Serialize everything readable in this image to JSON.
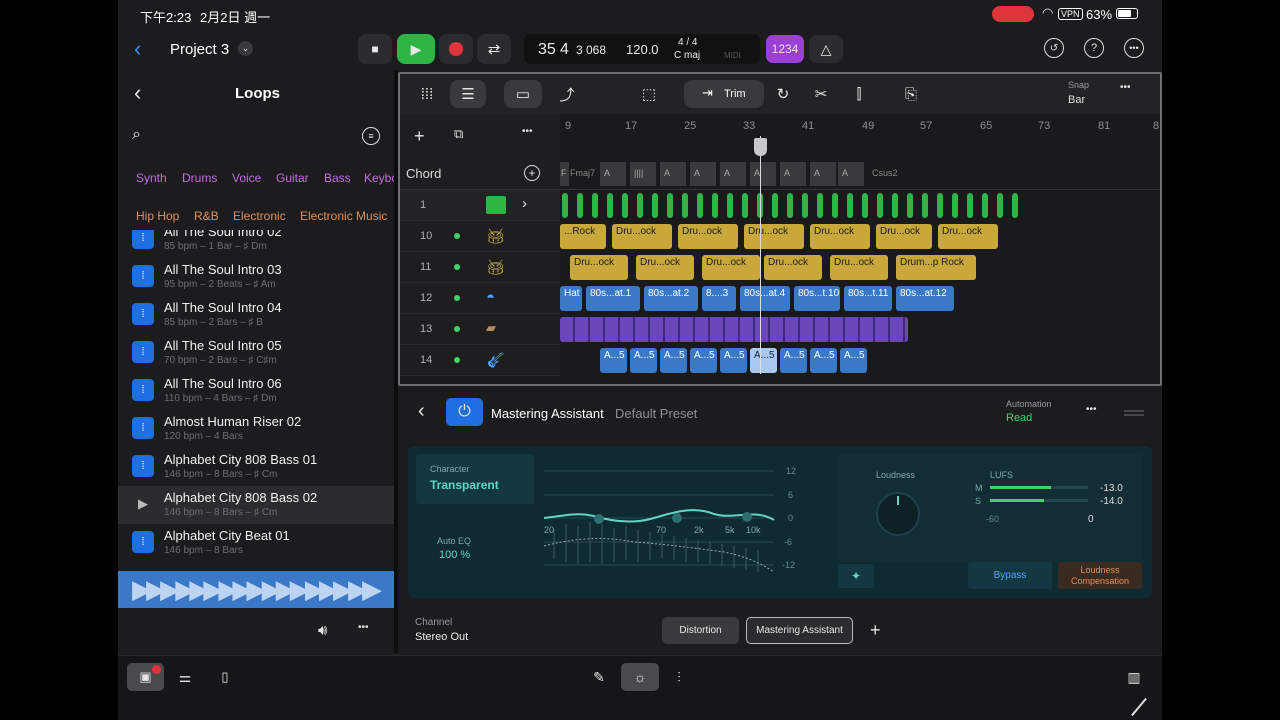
{
  "status": {
    "time": "下午2:23",
    "date": "2月2日 週一",
    "battery": "63%",
    "vpn": "VPN"
  },
  "project": {
    "title": "Project 3"
  },
  "lcd": {
    "bar": "35",
    "beat": "4",
    "sub": "3 068",
    "tempo": "120.0",
    "sig": "4 / 4",
    "key": "C maj",
    "count_in": "1234",
    "midi": "MIDI"
  },
  "loops": {
    "title": "Loops",
    "filters_row1": [
      "Synth",
      "Drums",
      "Voice",
      "Guitar",
      "Bass",
      "Keybo"
    ],
    "filters_row2": [
      "Hip Hop",
      "R&B",
      "Electronic",
      "Electronic Music"
    ],
    "items": [
      {
        "name": "All The Soul Intro 02",
        "meta": "85 bpm – 1 Bar – ♯ Dm"
      },
      {
        "name": "All The Soul Intro 03",
        "meta": "95 bpm – 2 Beats – ♯ Am"
      },
      {
        "name": "All The Soul Intro 04",
        "meta": "85 bpm – 2 Bars – ♯ B"
      },
      {
        "name": "All The Soul Intro 05",
        "meta": "70 bpm – 2 Bars – ♯ C♯m"
      },
      {
        "name": "All The Soul Intro 06",
        "meta": "110 bpm – 4 Bars – ♯ Dm"
      },
      {
        "name": "Almost Human Riser 02",
        "meta": "120 bpm – 4 Bars"
      },
      {
        "name": "Alphabet City 808 Bass 01",
        "meta": "146 bpm – 8 Bars – ♯ Cm"
      },
      {
        "name": "Alphabet City 808 Bass 02",
        "meta": "146 bpm – 8 Bars – ♯ Cm"
      },
      {
        "name": "Alphabet City Beat 01",
        "meta": "146 bpm – 8 Bars"
      }
    ]
  },
  "tracks": {
    "chord_label": "Chord",
    "trim": "Trim",
    "snap_label": "Snap",
    "snap_value": "Bar",
    "ruler": [
      "9",
      "17",
      "25",
      "33",
      "41",
      "49",
      "57",
      "65",
      "73",
      "81",
      "8"
    ],
    "chords": [
      "F",
      "Fmaj7",
      "A",
      "A",
      "A",
      "A",
      "A",
      "A",
      "A",
      "Csus2"
    ],
    "rows": [
      {
        "num": "1"
      },
      {
        "num": "10"
      },
      {
        "num": "11"
      },
      {
        "num": "12"
      },
      {
        "num": "13"
      },
      {
        "num": "14"
      }
    ],
    "row10": [
      "...Rock",
      "Dru...ock",
      "Dru...ock",
      "Dru...ock",
      "Dru...ock",
      "Dru...ock",
      "Dru...ock"
    ],
    "row11": [
      "Dru...ock",
      "Dru...ock",
      "Dru...ock",
      "Dru...ock",
      "Dru...ock",
      "Drum...p Rock"
    ],
    "row12": [
      "Hat",
      "80s...at.1",
      "80s...at.2",
      "8....3",
      "80s...at.4",
      "80s...t.10",
      "80s...t.11",
      "80s...at.12"
    ],
    "row14": [
      "A...5",
      "A...5",
      "A...5",
      "A...5",
      "A...5",
      "A...5",
      "A...5",
      "A...5",
      "A...5"
    ]
  },
  "plugin": {
    "name": "Mastering Assistant",
    "preset": "Default Preset",
    "automation_label": "Automation",
    "automation_value": "Read",
    "character_label": "Character",
    "character_value": "Transparent",
    "autoeq_label": "Auto EQ",
    "autoeq_value": "100 %",
    "db_ticks": [
      "12",
      "6",
      "0",
      "-6",
      "-12"
    ],
    "freq_ticks": [
      "20",
      "70",
      "2k",
      "5k",
      "10k"
    ],
    "loudness_label": "Loudness",
    "lufs_label": "LUFS",
    "m_label": "M",
    "s_label": "S",
    "m_value": "-13.0",
    "s_value": "-14.0",
    "scale_min": "-60",
    "scale_zero": "0",
    "bypass": "Bypass",
    "loudness_comp": "Loudness Compensation",
    "m_level": 0.62,
    "s_level": 0.55
  },
  "channel": {
    "label": "Channel",
    "value": "Stereo Out",
    "slots": [
      "Distortion",
      "Mastering Assistant"
    ]
  },
  "colors": {
    "accent_green": "#3ed463",
    "accent_purple": "#9b3fd6",
    "teal": "#5fd6c6",
    "record": "#e0343b"
  }
}
